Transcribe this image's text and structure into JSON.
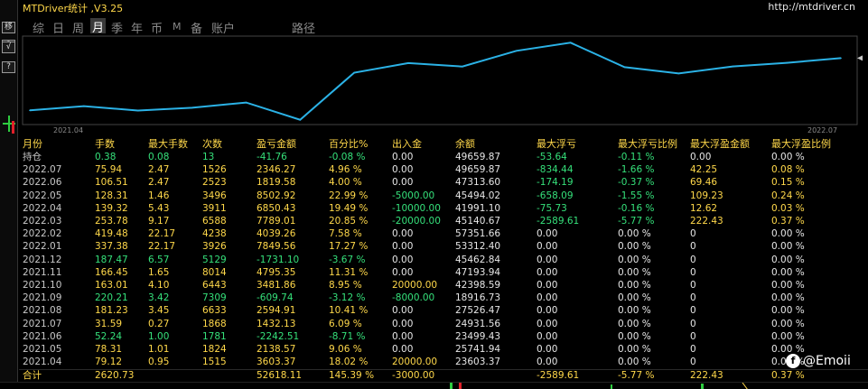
{
  "window": {
    "title": "MTDriver统计 ,V3.25",
    "url": "http://mtdriver.cn"
  },
  "toolbar": {
    "buttons": [
      "移",
      "?",
      "√",
      "?"
    ]
  },
  "tabs": [
    {
      "label": "综",
      "active": false
    },
    {
      "label": "日",
      "active": false
    },
    {
      "label": "周",
      "active": false
    },
    {
      "label": "月",
      "active": true
    },
    {
      "label": "季",
      "active": false
    },
    {
      "label": "年",
      "active": false
    },
    {
      "label": "币",
      "active": false
    },
    {
      "label": "M",
      "active": false
    },
    {
      "label": "备",
      "active": false
    },
    {
      "label": "账户",
      "active": false
    },
    {
      "label": "路径",
      "active": false
    }
  ],
  "chart_data": {
    "type": "line",
    "x_start_label": "2021.04",
    "x_end_label": "2022.07",
    "x": [
      "2021.04",
      "2021.05",
      "2021.06",
      "2021.07",
      "2021.08",
      "2021.09",
      "2021.10",
      "2021.11",
      "2021.12",
      "2022.01",
      "2022.02",
      "2022.03",
      "2022.04",
      "2022.05",
      "2022.06",
      "2022.07"
    ],
    "values": [
      23603.37,
      25741.94,
      23499.43,
      24931.56,
      27526.47,
      18916.73,
      42398.59,
      47193.94,
      45462.84,
      53312.4,
      57351.66,
      45140.67,
      41991.1,
      45494.02,
      47313.6,
      49659.87
    ],
    "line_color": "#2bb2e6"
  },
  "table": {
    "headers": [
      "月份",
      "手数",
      "最大手数",
      "次数",
      "盈亏金额",
      "百分比%",
      "出入金",
      "余额",
      "最大浮亏",
      "最大浮亏比例",
      "最大浮盈金额",
      "最大浮盈比例"
    ],
    "rows": [
      [
        "持仓",
        "0.38",
        "0.08",
        "13",
        "-41.76",
        "-0.08 %",
        "0.00",
        "49659.87",
        "-53.64",
        "-0.11 %",
        "0.00",
        "0.00 %"
      ],
      [
        "2022.07",
        "75.94",
        "2.47",
        "1526",
        "2346.27",
        "4.96 %",
        "0.00",
        "49659.87",
        "-834.44",
        "-1.66 %",
        "42.25",
        "0.08 %"
      ],
      [
        "2022.06",
        "106.51",
        "2.47",
        "2523",
        "1819.58",
        "4.00 %",
        "0.00",
        "47313.60",
        "-174.19",
        "-0.37 %",
        "69.46",
        "0.15 %"
      ],
      [
        "2022.05",
        "128.31",
        "1.46",
        "3496",
        "8502.92",
        "22.99 %",
        "-5000.00",
        "45494.02",
        "-658.09",
        "-1.55 %",
        "109.23",
        "0.24 %"
      ],
      [
        "2022.04",
        "139.32",
        "5.43",
        "3911",
        "6850.43",
        "19.49 %",
        "-10000.00",
        "41991.10",
        "-75.73",
        "-0.16 %",
        "12.62",
        "0.03 %"
      ],
      [
        "2022.03",
        "253.78",
        "9.17",
        "6588",
        "7789.01",
        "20.85 %",
        "-20000.00",
        "45140.67",
        "-2589.61",
        "-5.77 %",
        "222.43",
        "0.37 %"
      ],
      [
        "2022.02",
        "419.48",
        "22.17",
        "4238",
        "4039.26",
        "7.58 %",
        "0.00",
        "57351.66",
        "0.00",
        "0.00 %",
        "0",
        "0.00 %"
      ],
      [
        "2022.01",
        "337.38",
        "22.17",
        "3926",
        "7849.56",
        "17.27 %",
        "0.00",
        "53312.40",
        "0.00",
        "0.00 %",
        "0",
        "0.00 %"
      ],
      [
        "2021.12",
        "187.47",
        "6.57",
        "5129",
        "-1731.10",
        "-3.67 %",
        "0.00",
        "45462.84",
        "0.00",
        "0.00 %",
        "0",
        "0.00 %"
      ],
      [
        "2021.11",
        "166.45",
        "1.65",
        "8014",
        "4795.35",
        "11.31 %",
        "0.00",
        "47193.94",
        "0.00",
        "0.00 %",
        "0",
        "0.00 %"
      ],
      [
        "2021.10",
        "163.01",
        "4.10",
        "6443",
        "3481.86",
        "8.95 %",
        "20000.00",
        "42398.59",
        "0.00",
        "0.00 %",
        "0",
        "0.00 %"
      ],
      [
        "2021.09",
        "220.21",
        "3.42",
        "7309",
        "-609.74",
        "-3.12 %",
        "-8000.00",
        "18916.73",
        "0.00",
        "0.00 %",
        "0",
        "0.00 %"
      ],
      [
        "2021.08",
        "181.23",
        "3.45",
        "6633",
        "2594.91",
        "10.41 %",
        "0.00",
        "27526.47",
        "0.00",
        "0.00 %",
        "0",
        "0.00 %"
      ],
      [
        "2021.07",
        "31.59",
        "0.27",
        "1868",
        "1432.13",
        "6.09 %",
        "0.00",
        "24931.56",
        "0.00",
        "0.00 %",
        "0",
        "0.00 %"
      ],
      [
        "2021.06",
        "52.24",
        "1.00",
        "1781",
        "-2242.51",
        "-8.71 %",
        "0.00",
        "23499.43",
        "0.00",
        "0.00 %",
        "0",
        "0.00 %"
      ],
      [
        "2021.05",
        "78.31",
        "1.01",
        "1824",
        "2138.57",
        "9.06 %",
        "0.00",
        "25741.94",
        "0.00",
        "0.00 %",
        "0",
        "0.00 %"
      ],
      [
        "2021.04",
        "79.12",
        "0.95",
        "1515",
        "3603.37",
        "18.02 %",
        "20000.00",
        "23603.37",
        "0.00",
        "0.00 %",
        "0",
        "0.00 %"
      ]
    ],
    "total": [
      "合计",
      "2620.73",
      "",
      "",
      "52618.11",
      "145.39 %",
      "-3000.00",
      "",
      "-2589.61",
      "-5.77 %",
      "222.43",
      "0.37 %"
    ]
  },
  "watermark": {
    "icon": "facebook-icon",
    "text": "@Emoii"
  },
  "colors": {
    "yellow": "#ffd84a",
    "green": "#35e07a",
    "white": "#e6e6e6",
    "line": "#2bb2e6"
  }
}
